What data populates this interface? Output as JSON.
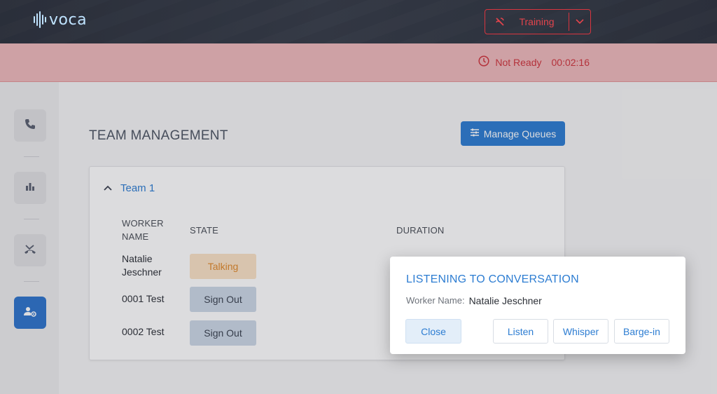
{
  "header": {
    "logo_text": "voca",
    "status_select": {
      "label": "Training",
      "icon": "call-end-icon"
    }
  },
  "status_bar": {
    "label": "Not Ready",
    "timer": "00:02:16",
    "icon": "clock-icon"
  },
  "sidebar": {
    "items": [
      {
        "name": "phone",
        "icon": "phone-icon",
        "active": false
      },
      {
        "name": "stats",
        "icon": "bar-chart-icon",
        "active": false
      },
      {
        "name": "missed-calls",
        "icon": "missed-call-icon",
        "active": false
      },
      {
        "name": "team-management",
        "icon": "user-settings-icon",
        "active": true
      }
    ]
  },
  "page": {
    "title": "TEAM MANAGEMENT",
    "manage_queues_button": "Manage Queues"
  },
  "team": {
    "name": "Team 1",
    "columns": {
      "worker_name": "WORKER NAME",
      "state": "STATE",
      "duration": "DURATION"
    },
    "rows": [
      {
        "worker": "Natalie Jeschner",
        "state": "Talking"
      },
      {
        "worker": "0001 Test",
        "state": "Sign Out"
      },
      {
        "worker": "0002 Test",
        "state": "Sign Out"
      }
    ]
  },
  "dialog": {
    "title": "LISTENING TO CONVERSATION",
    "worker_label": "Worker Name:",
    "worker_value": "Natalie Jeschner",
    "buttons": {
      "close": "Close",
      "listen": "Listen",
      "whisper": "Whisper",
      "barge_in": "Barge-in"
    }
  },
  "colors": {
    "accent": "#2d7dd2",
    "alert": "#d9353f",
    "status_strip": "#efb9bb",
    "talking": "#e08a2c"
  }
}
